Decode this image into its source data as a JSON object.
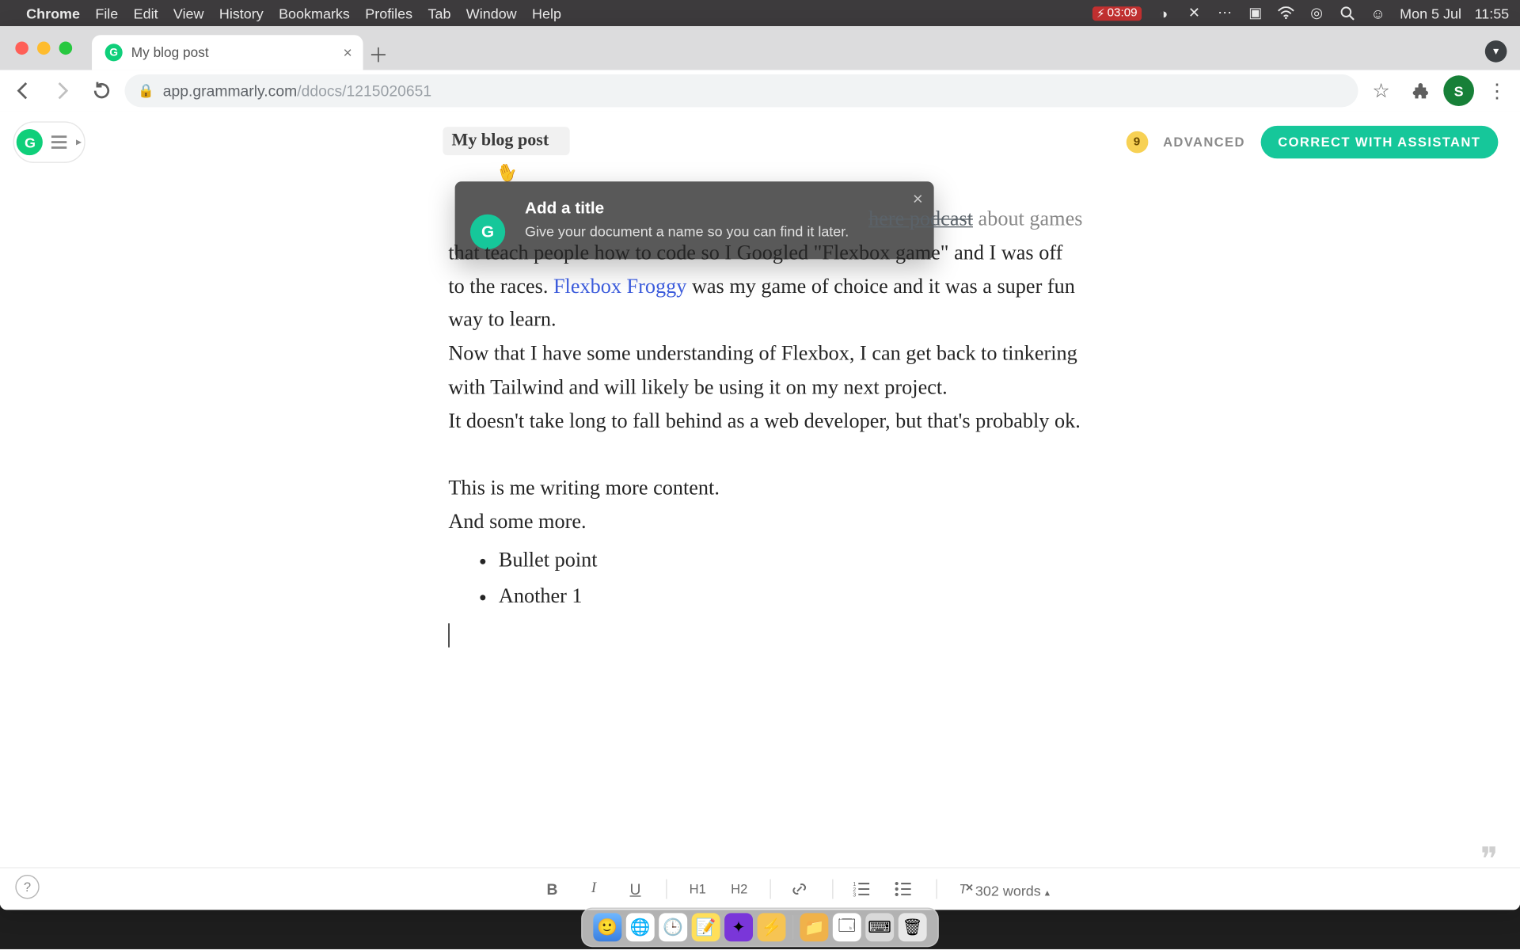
{
  "menubar": {
    "app": "Chrome",
    "items": [
      "File",
      "Edit",
      "View",
      "History",
      "Bookmarks",
      "Profiles",
      "Tab",
      "Window",
      "Help"
    ],
    "recording_time": "03:09",
    "date": "Mon 5 Jul",
    "time": "11:55"
  },
  "chrome": {
    "tab_title": "My blog post",
    "url_host": "app.grammarly.com",
    "url_path": "/ddocs/1215020651",
    "profile_initial": "S"
  },
  "app": {
    "doc_title": "My blog post",
    "score": "9",
    "advanced_label": "ADVANCED",
    "assistant_btn": "CORRECT WITH ASSISTANT",
    "tooltip": {
      "title": "Add a title",
      "body": "Give your document a name so you can find it later."
    },
    "word_count": "302 words"
  },
  "doc": {
    "frag_top": " about games",
    "p1_a": "that teach people how to code so I Googled \"Flexbox game\" and I was off to the races. ",
    "p1_link": "Flexbox Froggy",
    "p1_b": " was my game of choice and it was a super fun way to learn.",
    "p2": "Now that I have some understanding of Flexbox, I can get back to tinkering with Tailwind and will likely be using it on my next project.",
    "p3": "It doesn't take long to fall behind as a web developer, but that's probably ok.",
    "p4": "This is me writing more content.",
    "p5": "And some more.",
    "bullets": [
      "Bullet point",
      "Another 1"
    ]
  },
  "format_bar": {
    "bold": "B",
    "italic": "I",
    "underline": "U",
    "h1": "H1",
    "h2": "H2"
  },
  "dock": {
    "items": [
      "finder",
      "chrome",
      "time",
      "notes",
      "whimsical",
      "voice",
      "folder",
      "screens",
      "keyboard",
      "trash"
    ]
  }
}
